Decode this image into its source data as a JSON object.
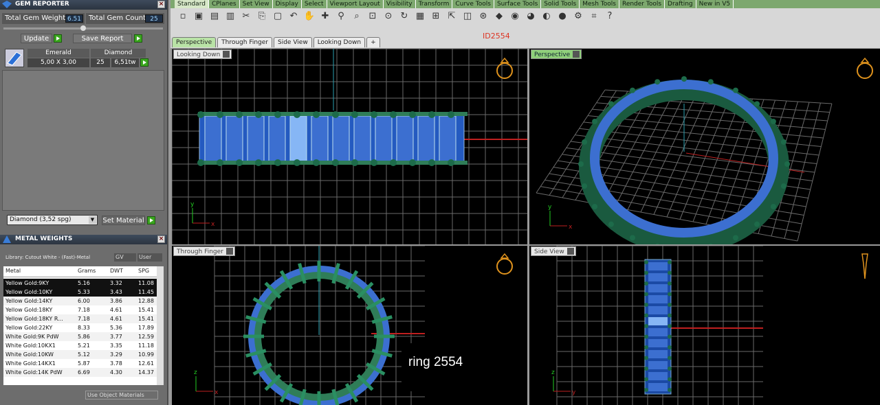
{
  "gem_reporter": {
    "title": "GEM REPORTER",
    "total_gem_weight_label": "Total Gem Weight",
    "total_gem_weight": "6.51",
    "total_gem_count_label": "Total Gem Count",
    "total_gem_count": "25",
    "update_label": "Update",
    "save_report_label": "Save Report",
    "columns": [
      "Emerald",
      "Diamond"
    ],
    "size": "5,00 X 3,00",
    "count": "25",
    "weight": "6,51tw"
  },
  "material": {
    "selected": "Diamond    (3,52 spg)",
    "set_material_label": "Set Material"
  },
  "metal_weights": {
    "title": "METAL WEIGHTS",
    "library": "Library: Cutout White - (Fast)-Metal",
    "gv_label": "GV",
    "user_label": "User",
    "headers": [
      "Metal",
      "Grams",
      "DWT",
      "SPG"
    ],
    "rows": [
      [
        "Yellow Gold:9KY",
        "5.16",
        "3.32",
        "11.08"
      ],
      [
        "Yellow Gold:10KY",
        "5.33",
        "3.43",
        "11.45"
      ],
      [
        "Yellow Gold:14KY",
        "6.00",
        "3.86",
        "12.88"
      ],
      [
        "Yellow Gold:18KY",
        "7.18",
        "4.61",
        "15.41"
      ],
      [
        "Yellow Gold:18KY R...",
        "7.18",
        "4.61",
        "15.41"
      ],
      [
        "Yellow Gold:22KY",
        "8.33",
        "5.36",
        "17.89"
      ],
      [
        "White Gold:9K PdW",
        "5.86",
        "3.77",
        "12.59"
      ],
      [
        "White Gold:10KX1",
        "5.21",
        "3.35",
        "11.18"
      ],
      [
        "White Gold:10KW",
        "5.12",
        "3.29",
        "10.99"
      ],
      [
        "White Gold:14KX1",
        "5.87",
        "3.78",
        "12.61"
      ],
      [
        "White Gold:14K PdW",
        "6.69",
        "4.30",
        "14.37"
      ]
    ],
    "use_object_materials": "Use Object Materials"
  },
  "toolbar_tabs": [
    "Standard",
    "CPlanes",
    "Set View",
    "Display",
    "Select",
    "Viewport Layout",
    "Visibility",
    "Transform",
    "Curve Tools",
    "Surface Tools",
    "Solid Tools",
    "Mesh Tools",
    "Render Tools",
    "Drafting",
    "New in V5"
  ],
  "tools": [
    "new-icon",
    "open-icon",
    "save-icon",
    "print-icon",
    "copy-icon",
    "cut-icon",
    "paste-icon",
    "undo-icon",
    "pan-icon",
    "move-icon",
    "zoom-icon",
    "zoom-window-icon",
    "zoom-extents-icon",
    "zoom-selected-icon",
    "rotate-icon",
    "four-view-icon",
    "cplane-icon",
    "select-icon",
    "layer-icon",
    "light-icon",
    "render-icon",
    "material-icon",
    "color-icon",
    "shade-icon",
    "sphere-icon",
    "settings-icon",
    "grid-icon",
    "help-icon"
  ],
  "tool_glyphs": [
    "▫",
    "▣",
    "▤",
    "▥",
    "✂",
    "⎘",
    "▢",
    "↶",
    "✋",
    "✚",
    "⚲",
    "⌕",
    "⊡",
    "⊙",
    "↻",
    "▦",
    "⊞",
    "⇱",
    "◫",
    "⊛",
    "◆",
    "◉",
    "◕",
    "◐",
    "●",
    "⚙",
    "⌗",
    "?"
  ],
  "viewport_tabs": [
    "Perspective",
    "Through Finger",
    "Side View",
    "Looking Down"
  ],
  "document_id": "ID2554",
  "viewports": {
    "top_left": "Looking Down",
    "top_right": "Perspective",
    "bottom_left": "Through Finger",
    "bottom_right": "Side View"
  },
  "caption": "ring 2554",
  "colors": {
    "band": "#2f7d58",
    "gem": "#3c6fd0",
    "grid": "#6a6a6a",
    "axis_x": "#c02020",
    "axis_y": "#2a9fb0",
    "ring_icon": "#e0931d"
  }
}
